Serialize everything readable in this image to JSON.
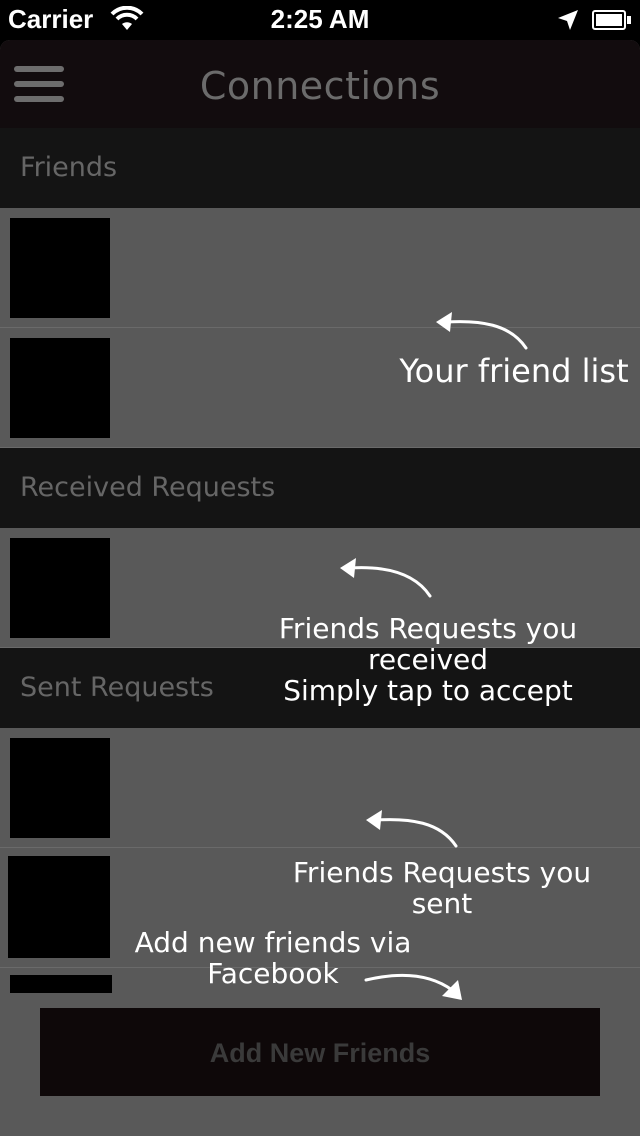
{
  "status_bar": {
    "carrier": "Carrier",
    "time": "2:25 AM"
  },
  "navbar": {
    "title": "Connections"
  },
  "sections": {
    "friends": "Friends",
    "received": "Received Requests",
    "sent": "Sent Requests"
  },
  "annotations": {
    "friend_list": "Your friend list",
    "received_line1": "Friends Requests you",
    "received_line2": "received",
    "received_line3": "Simply tap to accept",
    "sent": "Friends Requests you sent",
    "add_line1": "Add new friends via",
    "add_line2": "Facebook"
  },
  "add_button_label": "Add New Friends"
}
